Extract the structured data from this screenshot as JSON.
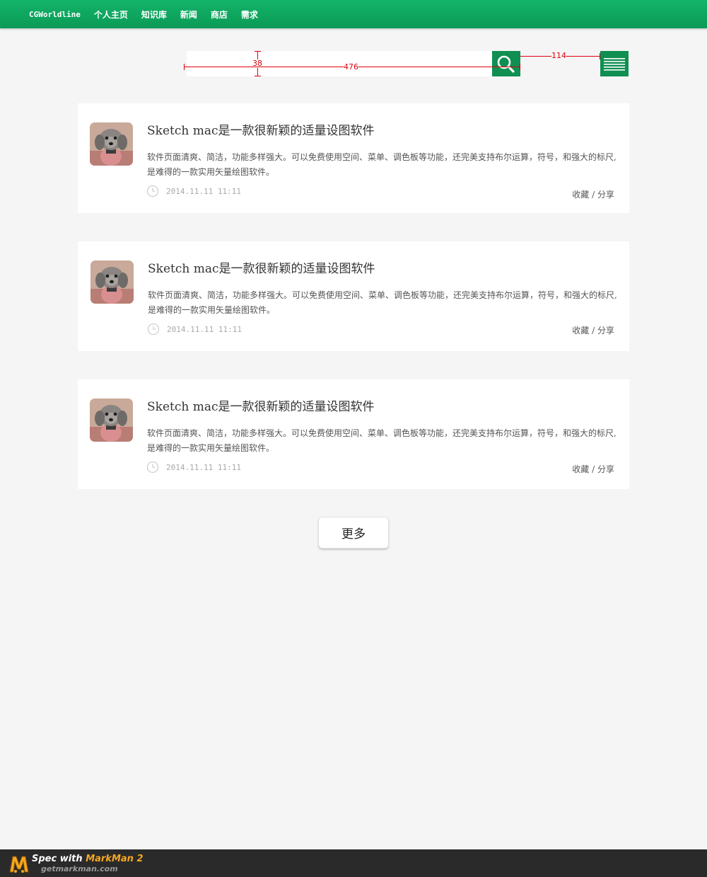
{
  "nav": {
    "brand": "CGWorldline",
    "items": [
      {
        "label": "个人主页"
      },
      {
        "label": "知识库"
      },
      {
        "label": "新闻"
      },
      {
        "label": "商店"
      },
      {
        "label": "需求"
      }
    ]
  },
  "search": {
    "value": "",
    "placeholder": ""
  },
  "spec_labels": {
    "height": "38",
    "width": "476",
    "gap": "114"
  },
  "colors": {
    "brand_green": "#0f8f52",
    "spec_red": "#e0000a"
  },
  "articles": [
    {
      "title": "Sketch mac是一款很新颖的适量设图软件",
      "description": "软件页面清爽、简洁，功能多样强大。可以免费使用空间、菜单、调色板等功能，还完美支持布尔运算，符号，和强大的标尺,是难得的一款实用矢量绘图软件。",
      "time": "2014.11.11 11:11",
      "collect": "收藏",
      "separator": "/",
      "share": "分享",
      "avatar_icon": "dog-avatar"
    },
    {
      "title": "Sketch mac是一款很新颖的适量设图软件",
      "description": "软件页面清爽、简洁，功能多样强大。可以免费使用空间、菜单、调色板等功能，还完美支持布尔运算，符号，和强大的标尺,是难得的一款实用矢量绘图软件。",
      "time": "2014.11.11 11:11",
      "collect": "收藏",
      "separator": "/",
      "share": "分享",
      "avatar_icon": "dog-avatar"
    },
    {
      "title": "Sketch mac是一款很新颖的适量设图软件",
      "description": "软件页面清爽、简洁，功能多样强大。可以免费使用空间、菜单、调色板等功能，还完美支持布尔运算，符号，和强大的标尺,是难得的一款实用矢量绘图软件。",
      "time": "2014.11.11 11:11",
      "collect": "收藏",
      "separator": "/",
      "share": "分享",
      "avatar_icon": "dog-avatar"
    }
  ],
  "more_label": "更多",
  "footer": {
    "spec_with": "Spec with ",
    "product": "MarkMan 2",
    "site": "getmarkman.com"
  }
}
